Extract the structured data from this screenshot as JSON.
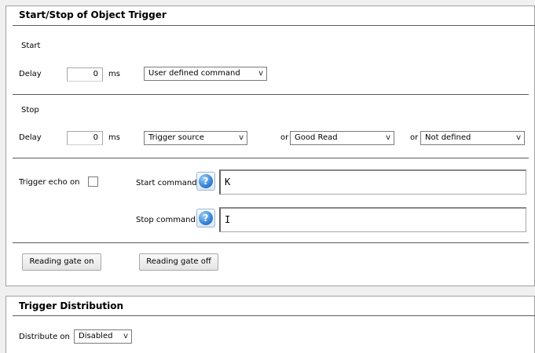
{
  "trigger_panel": {
    "title": "Start/Stop of Object Trigger",
    "start": {
      "section_label": "Start",
      "delay_label": "Delay",
      "delay_value": "0",
      "delay_unit": "ms",
      "mode_select": "User defined command"
    },
    "stop": {
      "section_label": "Stop",
      "delay_label": "Delay",
      "delay_value": "0",
      "delay_unit": "ms",
      "source_select": "Trigger source",
      "or_label_1": "or",
      "good_read_select": "Good Read",
      "or_label_2": "or",
      "not_defined_select": "Not defined"
    },
    "echo": {
      "label": "Trigger echo on",
      "checked": false
    },
    "start_command": {
      "label": "Start command",
      "value": "K"
    },
    "stop_command": {
      "label": "Stop command",
      "value": "I"
    },
    "buttons": {
      "gate_on": "Reading gate on",
      "gate_off": "Reading gate off"
    }
  },
  "distribution_panel": {
    "title": "Trigger Distribution",
    "distribute_label": "Distribute on",
    "distribute_select": "Disabled"
  },
  "icons": {
    "help": "?",
    "dropdown": "v"
  },
  "colors": {
    "help_icon": "#3b88d8",
    "panel_border": "#a0a0a0"
  }
}
